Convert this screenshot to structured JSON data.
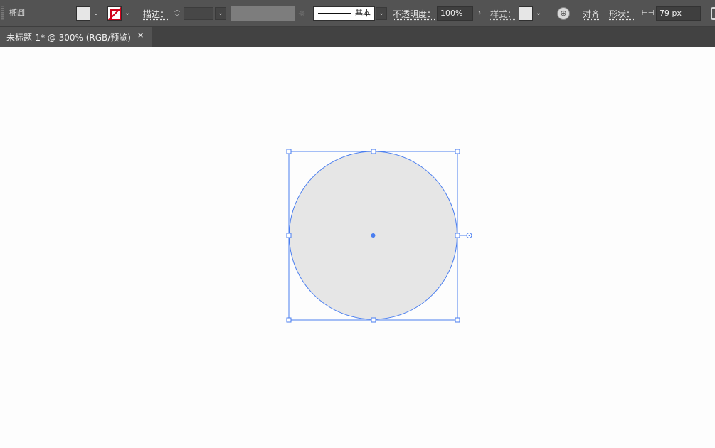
{
  "control_bar": {
    "tool_name": "椭圆",
    "stroke_label": "描边：",
    "profile_label": "基本",
    "opacity_label": "不透明度：",
    "opacity_value": "100%",
    "style_label": "样式：",
    "align_label": "对齐",
    "shape_label": "形状：",
    "width_value": "79 px"
  },
  "tab_bar": {
    "document_tab": "未标题-1* @ 300% (RGB/预览)",
    "close_glyph": "×"
  },
  "colors": {
    "fill": "#e6e6e6",
    "selection": "#4a7ef0",
    "stroke_none_slash": "#d0021b"
  },
  "icons": [
    "grip-handle-icon",
    "chevron-down-icon",
    "stepper-icon",
    "brush-icon",
    "chevron-right-icon",
    "globe-icon",
    "width-icon"
  ]
}
